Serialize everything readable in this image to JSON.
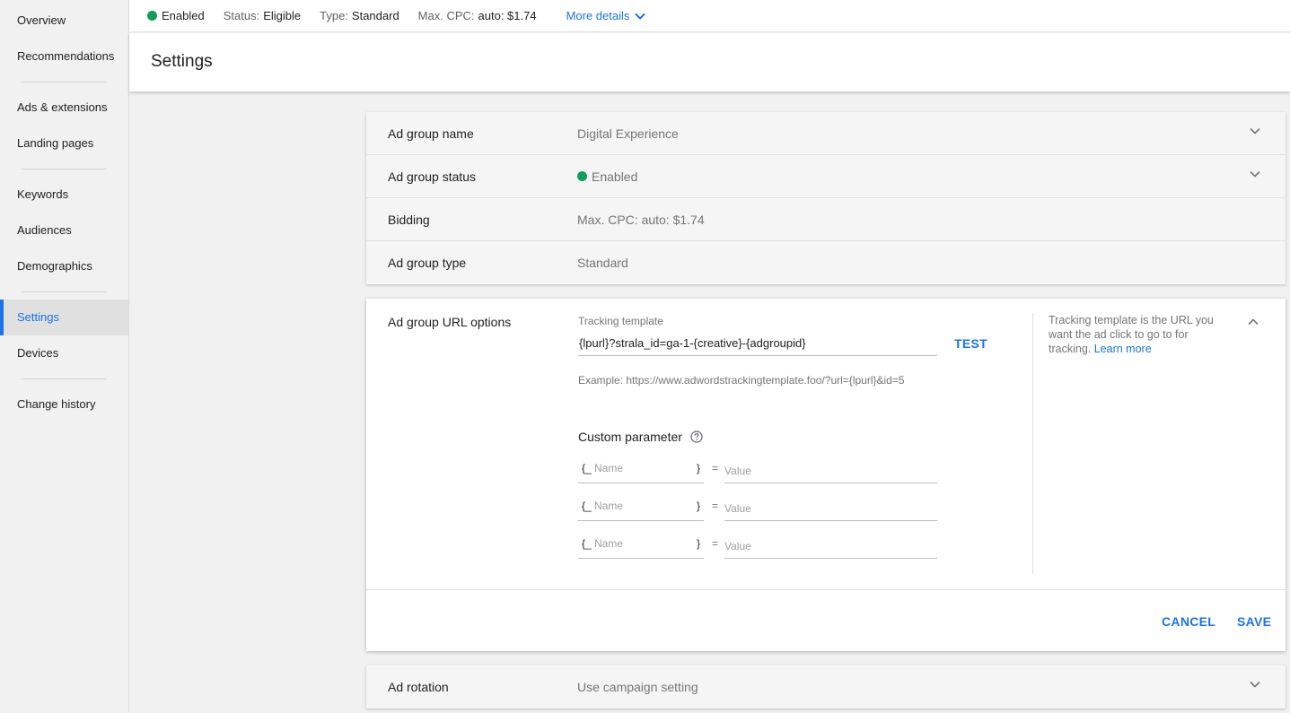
{
  "sidebar": {
    "groups": [
      [
        {
          "label": "Overview"
        },
        {
          "label": "Recommendations"
        }
      ],
      [
        {
          "label": "Ads & extensions"
        },
        {
          "label": "Landing pages"
        }
      ],
      [
        {
          "label": "Keywords"
        },
        {
          "label": "Audiences"
        },
        {
          "label": "Demographics"
        }
      ],
      [
        {
          "label": "Settings",
          "active": true
        },
        {
          "label": "Devices"
        }
      ],
      [
        {
          "label": "Change history"
        }
      ]
    ]
  },
  "statusbar": {
    "enabled": "Enabled",
    "status_label": "Status:",
    "status_value": "Eligible",
    "type_label": "Type:",
    "type_value": "Standard",
    "cpc_label": "Max. CPC:",
    "cpc_value": "auto: $1.74",
    "more_details": "More details"
  },
  "page": {
    "title": "Settings"
  },
  "settings_rows": [
    {
      "label": "Ad group name",
      "value": "Digital Experience",
      "chevron": true
    },
    {
      "label": "Ad group status",
      "value": "Enabled",
      "status_dot": true,
      "chevron": true
    },
    {
      "label": "Bidding",
      "value": "Max. CPC: auto: $1.74",
      "chevron": false
    },
    {
      "label": "Ad group type",
      "value": "Standard",
      "chevron": false
    }
  ],
  "url_options": {
    "label": "Ad group URL options",
    "tracking_template_label": "Tracking template",
    "tracking_template_value": "{lpurl}?strala_id=ga-1-{creative}-{adgroupid}",
    "test_label": "TEST",
    "example": "Example: https://www.adwordstrackingtemplate.foo/?url={lpurl}&id=5",
    "custom_parameter_label": "Custom parameter",
    "params": [
      {
        "brace_open": "{_",
        "name_placeholder": "Name",
        "brace_close": "}",
        "equals": "=",
        "value_placeholder": "Value"
      },
      {
        "brace_open": "{_",
        "name_placeholder": "Name",
        "brace_close": "}",
        "equals": "=",
        "value_placeholder": "Value"
      },
      {
        "brace_open": "{_",
        "name_placeholder": "Name",
        "brace_close": "}",
        "equals": "=",
        "value_placeholder": "Value"
      }
    ],
    "help_text": "Tracking template is the URL you want the ad click to go to for tracking.",
    "learn_more": "Learn more",
    "cancel_label": "CANCEL",
    "save_label": "SAVE"
  },
  "ad_rotation": {
    "label": "Ad rotation",
    "value": "Use campaign setting"
  },
  "colors": {
    "accent": "#1a73e8",
    "status_green": "#0f9d58"
  }
}
